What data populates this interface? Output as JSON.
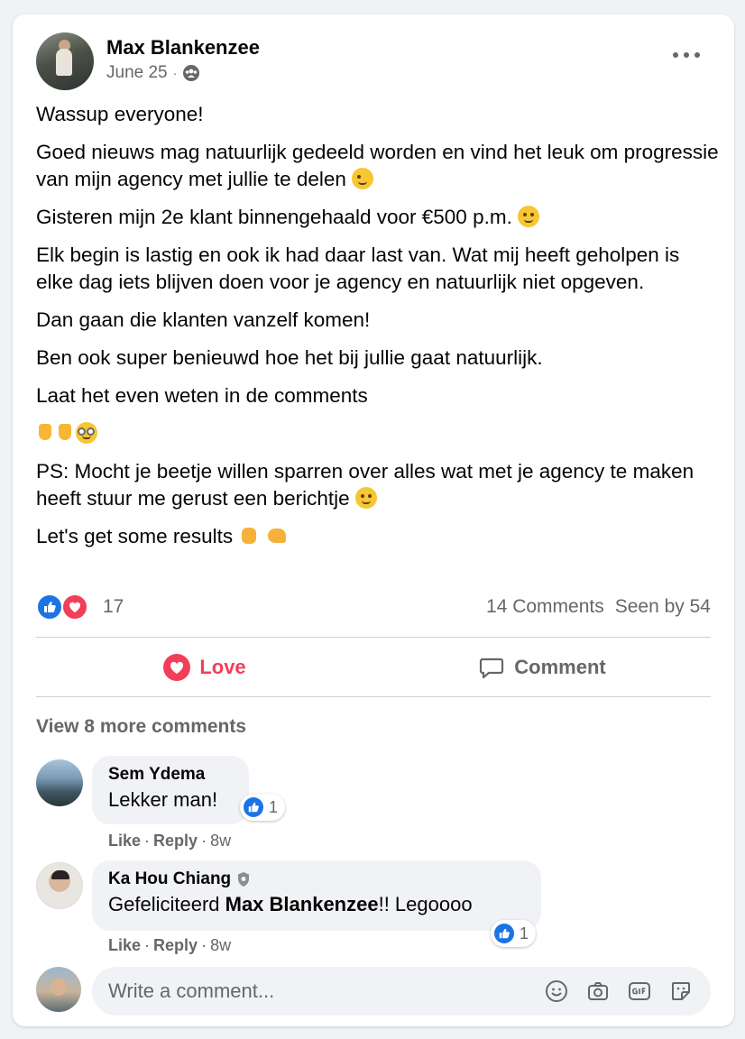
{
  "post": {
    "author": "Max Blankenzee",
    "date": "June 25",
    "meta_sep": "·",
    "privacy_icon": "group-icon",
    "paragraphs": {
      "p1": "Wassup everyone!",
      "p2": "Goed nieuws mag natuurlijk gedeeld worden en vind het leuk om progressie van mijn agency met jullie te delen",
      "p3": "Gisteren mijn 2e klant binnengehaald voor €500 p.m.",
      "p4": "Elk begin is lastig en ook ik had daar last van. Wat mij heeft geholpen is elke dag iets blijven doen voor je agency en natuurlijk niet opgeven.",
      "p5": "Dan gaan die klanten vanzelf komen!",
      "p6": "Ben ook super benieuwd hoe het bij jullie gaat natuurlijk.",
      "p7": "Laat het even weten in de comments",
      "p9": "PS: Mocht je beetje willen sparren over alles wat met je agency te maken heeft stuur me gerust een berichtje",
      "p10": "Let's get some results"
    }
  },
  "stats": {
    "reaction_count": "17",
    "comments": "14 Comments",
    "seen": "Seen by 54"
  },
  "actions": {
    "love": "Love",
    "comment": "Comment"
  },
  "colors": {
    "love": "#f33e58",
    "like": "#1b74e4",
    "muted": "#65676b"
  },
  "view_more": "View 8 more comments",
  "comments": [
    {
      "name": "Sem Ydema",
      "text": "Lekker man!",
      "likes": "1",
      "like": "Like",
      "reply": "Reply",
      "sep": "·",
      "time": "8w"
    },
    {
      "name": "Ka Hou Chiang",
      "text_before": "Gefeliciteerd ",
      "mention": "Max Blankenzee",
      "text_after": "!! Legoooo",
      "likes": "1",
      "like": "Like",
      "reply": "Reply",
      "sep": "·",
      "time": "8w"
    }
  ],
  "composer": {
    "placeholder": "Write a comment..."
  }
}
